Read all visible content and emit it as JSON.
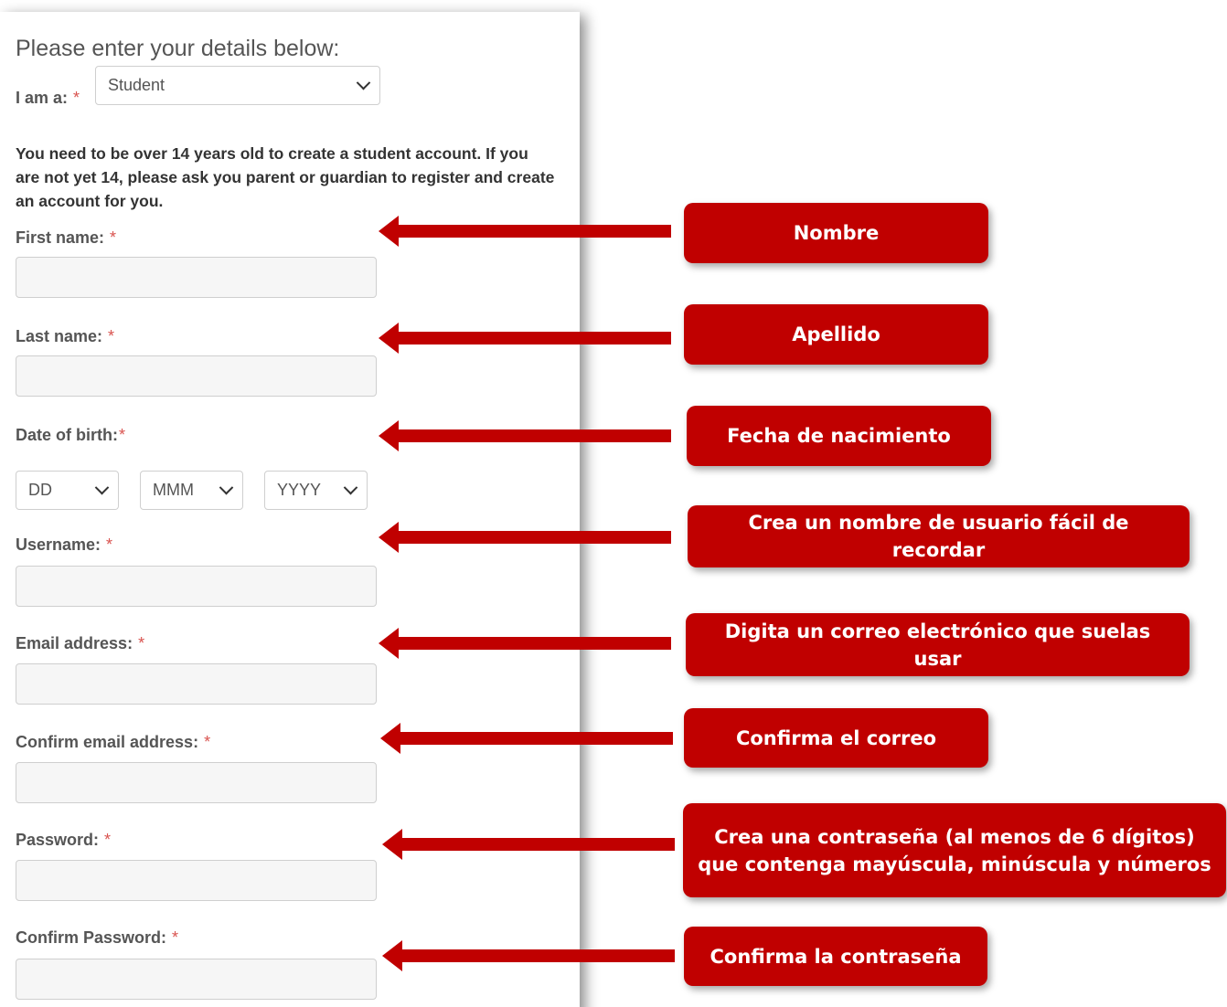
{
  "form": {
    "heading": "Please enter your details below:",
    "role_label": "I am a:",
    "role_value": "Student",
    "notice": "You need to be over 14 years old to create a student account. If you are not yet 14, please ask you parent or guardian to register and create an account for you.",
    "required_mark": "*",
    "first_name_label": "First name:",
    "last_name_label": "Last name:",
    "dob_label": "Date of birth:",
    "dob_day": "DD",
    "dob_month": "MMM",
    "dob_year": "YYYY",
    "username_label": "Username:",
    "email_label": "Email address:",
    "confirm_email_label": "Confirm email address:",
    "password_label": "Password:",
    "confirm_password_label": "Confirm Password:"
  },
  "callouts": {
    "first_name": "Nombre",
    "last_name": "Apellido",
    "dob": "Fecha de nacimiento",
    "username": "Crea un nombre de usuario fácil de recordar",
    "email": "Digita un correo electrónico que suelas usar",
    "confirm_email": "Confirma el correo",
    "password": "Crea una contraseña (al menos de 6 dígitos) que contenga mayúscula, minúscula y números",
    "confirm_password": "Confirma la contraseña"
  },
  "colors": {
    "callout_bg": "#c00000",
    "arrow": "#c00000",
    "required": "#d9534f"
  }
}
